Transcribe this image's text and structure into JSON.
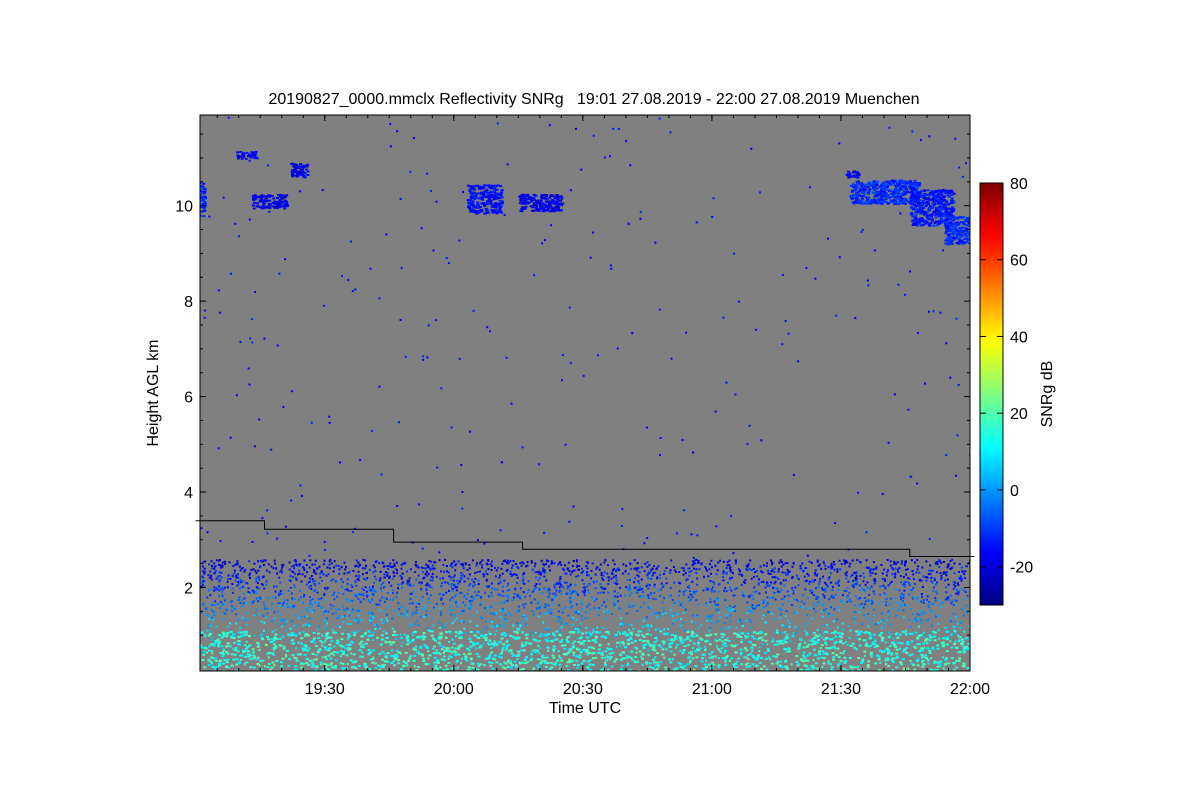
{
  "chart_data": {
    "type": "heatmap",
    "title": "20190827_0000.mmclx Reflectivity SNRg   19:01 27.08.2019 - 22:00 27.08.2019 Muenchen",
    "xlabel": "Time UTC",
    "ylabel": "Height AGL km",
    "colorbar_label": "SNRg dB",
    "xlim": [
      "19:01",
      "22:00"
    ],
    "ylim": [
      0.25,
      11.9
    ],
    "x_ticks": [
      {
        "label": "19:30",
        "minutes": 30
      },
      {
        "label": "20:00",
        "minutes": 60
      },
      {
        "label": "20:30",
        "minutes": 90
      },
      {
        "label": "21:00",
        "minutes": 120
      },
      {
        "label": "21:30",
        "minutes": 150
      },
      {
        "label": "22:00",
        "minutes": 180
      }
    ],
    "y_ticks": [
      {
        "label": "2",
        "value": 2
      },
      {
        "label": "4",
        "value": 4
      },
      {
        "label": "6",
        "value": 6
      },
      {
        "label": "8",
        "value": 8
      },
      {
        "label": "10",
        "value": 10
      }
    ],
    "colorbar_range": [
      -30,
      80
    ],
    "colorbar_ticks": [
      {
        "label": "-20",
        "value": -20
      },
      {
        "label": "0",
        "value": 0
      },
      {
        "label": "20",
        "value": 20
      },
      {
        "label": "40",
        "value": 40
      },
      {
        "label": "60",
        "value": 60
      },
      {
        "label": "80",
        "value": 80
      }
    ],
    "colormap": [
      "#00007f",
      "#0000ff",
      "#007fff",
      "#00ffff",
      "#7fff7f",
      "#ffff00",
      "#ff7f00",
      "#ff0000",
      "#7f0000"
    ],
    "background_color": "#808080",
    "threshold_line": {
      "description_none": "",
      "points": [
        {
          "t": 0,
          "h": 3.4
        },
        {
          "t": 16,
          "h": 3.4
        },
        {
          "t": 16,
          "h": 3.22
        },
        {
          "t": 46,
          "h": 3.22
        },
        {
          "t": 46,
          "h": 2.95
        },
        {
          "t": 76,
          "h": 2.95
        },
        {
          "t": 76,
          "h": 2.8
        },
        {
          "t": 166,
          "h": 2.8
        },
        {
          "t": 166,
          "h": 2.65
        },
        {
          "t": 181,
          "h": 2.65
        }
      ]
    },
    "cloud_layers": [
      {
        "t0": 0,
        "t1": 2,
        "h0": 9.8,
        "h1": 10.5,
        "snr": -12
      },
      {
        "t0": 13,
        "t1": 21,
        "h0": 9.95,
        "h1": 10.25,
        "snr": -18
      },
      {
        "t0": 9,
        "t1": 14,
        "h0": 11.0,
        "h1": 11.15,
        "snr": -18
      },
      {
        "t0": 22,
        "t1": 26,
        "h0": 10.6,
        "h1": 10.9,
        "snr": -18
      },
      {
        "t0": 63,
        "t1": 71,
        "h0": 9.85,
        "h1": 10.45,
        "snr": -15
      },
      {
        "t0": 75,
        "t1": 85,
        "h0": 9.9,
        "h1": 10.25,
        "snr": -18
      },
      {
        "t0": 152,
        "t1": 168,
        "h0": 10.05,
        "h1": 10.55,
        "snr": -12
      },
      {
        "t0": 166,
        "t1": 176,
        "h0": 9.6,
        "h1": 10.35,
        "snr": -14
      },
      {
        "t0": 174,
        "t1": 181,
        "h0": 9.2,
        "h1": 9.8,
        "snr": -12
      },
      {
        "t0": 151,
        "t1": 154,
        "h0": 10.6,
        "h1": 10.75,
        "snr": -18
      }
    ],
    "boundary_layer": {
      "top_km": 2.6,
      "dense_below_km": 1.8
    },
    "grid": false,
    "legend": "colorbar-right"
  }
}
